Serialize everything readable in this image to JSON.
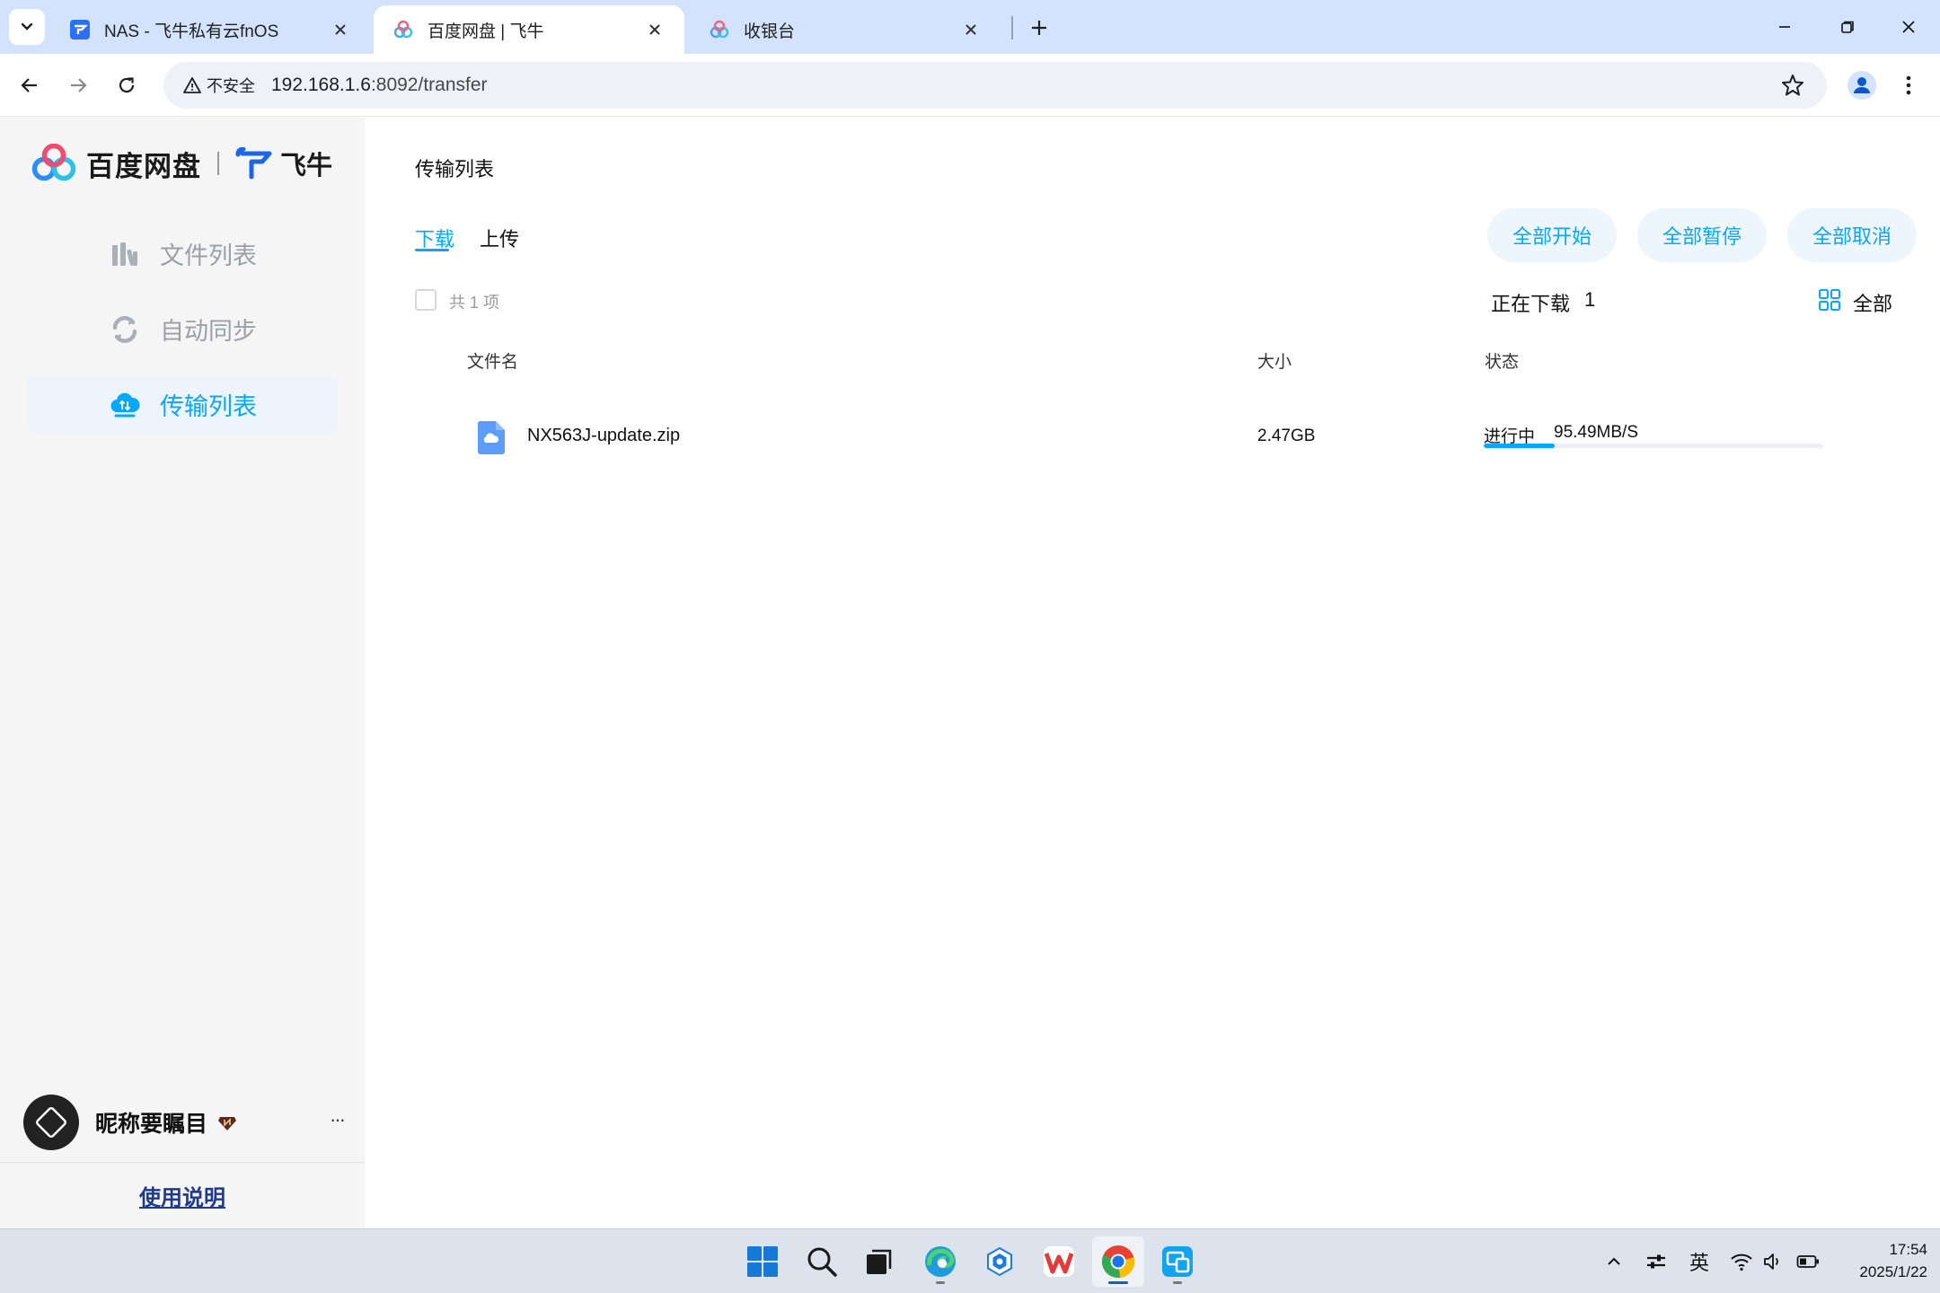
{
  "browser": {
    "tabs": [
      {
        "title": "NAS - 飞牛私有云fnOS",
        "active": false
      },
      {
        "title": "百度网盘 | 飞牛",
        "active": true
      },
      {
        "title": "收银台",
        "active": false
      }
    ],
    "security_label": "不安全",
    "url_host": "192.168.1.6",
    "url_rest": ":8092/transfer"
  },
  "sidebar": {
    "logo_baidu": "百度网盘",
    "logo_fn": "飞牛",
    "items": [
      {
        "label": "文件列表",
        "icon": "books-icon",
        "active": false
      },
      {
        "label": "自动同步",
        "icon": "sync-icon",
        "active": false
      },
      {
        "label": "传输列表",
        "icon": "cloud-transfer-icon",
        "active": true
      }
    ],
    "user": {
      "name": "昵称要瞩目",
      "more": "···"
    },
    "help_link": "使用说明"
  },
  "main": {
    "title": "传输列表",
    "subtabs": {
      "download": "下载",
      "upload": "上传",
      "active": "download"
    },
    "buttons": {
      "start_all": "全部开始",
      "pause_all": "全部暂停",
      "cancel_all": "全部取消"
    },
    "count_label": "共 1 项",
    "downloading_label": "正在下载",
    "downloading_count": "1",
    "view_label": "全部",
    "columns": {
      "name": "文件名",
      "size": "大小",
      "status": "状态"
    },
    "rows": [
      {
        "name": "NX563J-update.zip",
        "size": "2.47GB",
        "status": "进行中",
        "speed": "95.49MB/S",
        "progress_percent": 21
      }
    ]
  },
  "taskbar": {
    "apps": [
      "start-icon",
      "search-icon",
      "task-view-icon",
      "edge-icon",
      "app-icon",
      "wps-icon",
      "chrome-icon",
      "remote-desktop-icon"
    ],
    "ime": "英",
    "time": "17:54",
    "date": "2025/1/22"
  },
  "colors": {
    "accent": "#06a7ff",
    "tab_bar": "#d3e3fd",
    "sidebar_bg": "#f5f5f6"
  }
}
